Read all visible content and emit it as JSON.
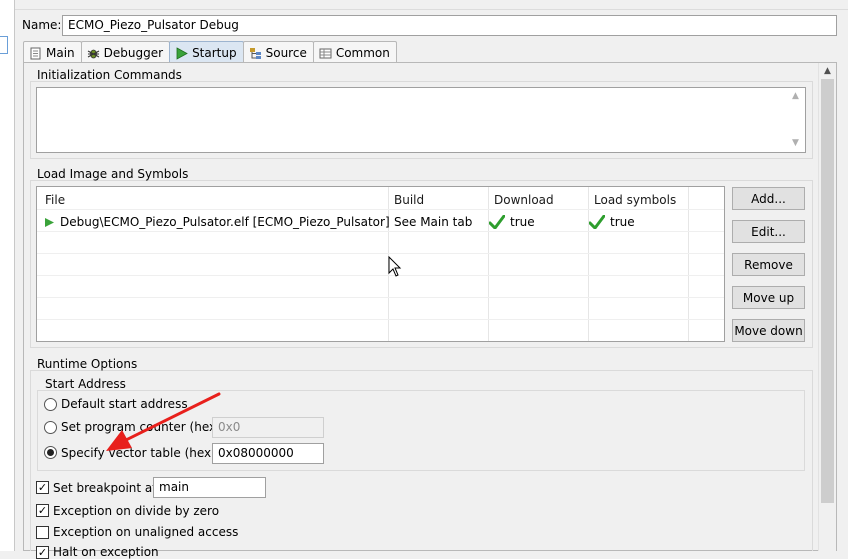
{
  "name_label": "Name:",
  "name_value": "ECMO_Piezo_Pulsator Debug",
  "tabs": [
    {
      "label": "Main",
      "icon": "page-icon"
    },
    {
      "label": "Debugger",
      "icon": "bug-icon"
    },
    {
      "label": "Startup",
      "icon": "run-icon"
    },
    {
      "label": "Source",
      "icon": "source-icon"
    },
    {
      "label": "Common",
      "icon": "table-icon"
    }
  ],
  "init": {
    "title": "Initialization Commands",
    "value": ""
  },
  "load": {
    "title": "Load Image and Symbols",
    "columns": [
      "File",
      "Build",
      "Download",
      "Load symbols"
    ],
    "rows": [
      {
        "file": "Debug\\ECMO_Piezo_Pulsator.elf [ECMO_Piezo_Pulsator]",
        "build": "See Main tab",
        "download": "true",
        "symbols": "true"
      }
    ],
    "buttons": {
      "add": "Add...",
      "edit": "Edit...",
      "remove": "Remove",
      "move_up": "Move up",
      "move_down": "Move down"
    }
  },
  "runtime": {
    "title": "Runtime Options",
    "start_address": {
      "title": "Start Address",
      "default_label": "Default start address",
      "pc_label": "Set program counter (hex):",
      "pc_value": "0x0",
      "vector_label": "Specify vector table (hex):",
      "vector_value": "0x08000000",
      "selected": "vector"
    },
    "breakpoint_label": "Set breakpoint at:",
    "breakpoint_value": "main",
    "breakpoint_checked": true,
    "divide_label": "Exception on divide by zero",
    "divide_checked": true,
    "unaligned_label": "Exception on unaligned access",
    "unaligned_checked": false,
    "halt_label": "Halt on exception",
    "halt_checked": true
  },
  "colors": {
    "arrow": "#e8201c",
    "check": "#2e9e2e",
    "run": "#3aa33a",
    "active_tab": "#dbe6f2"
  }
}
